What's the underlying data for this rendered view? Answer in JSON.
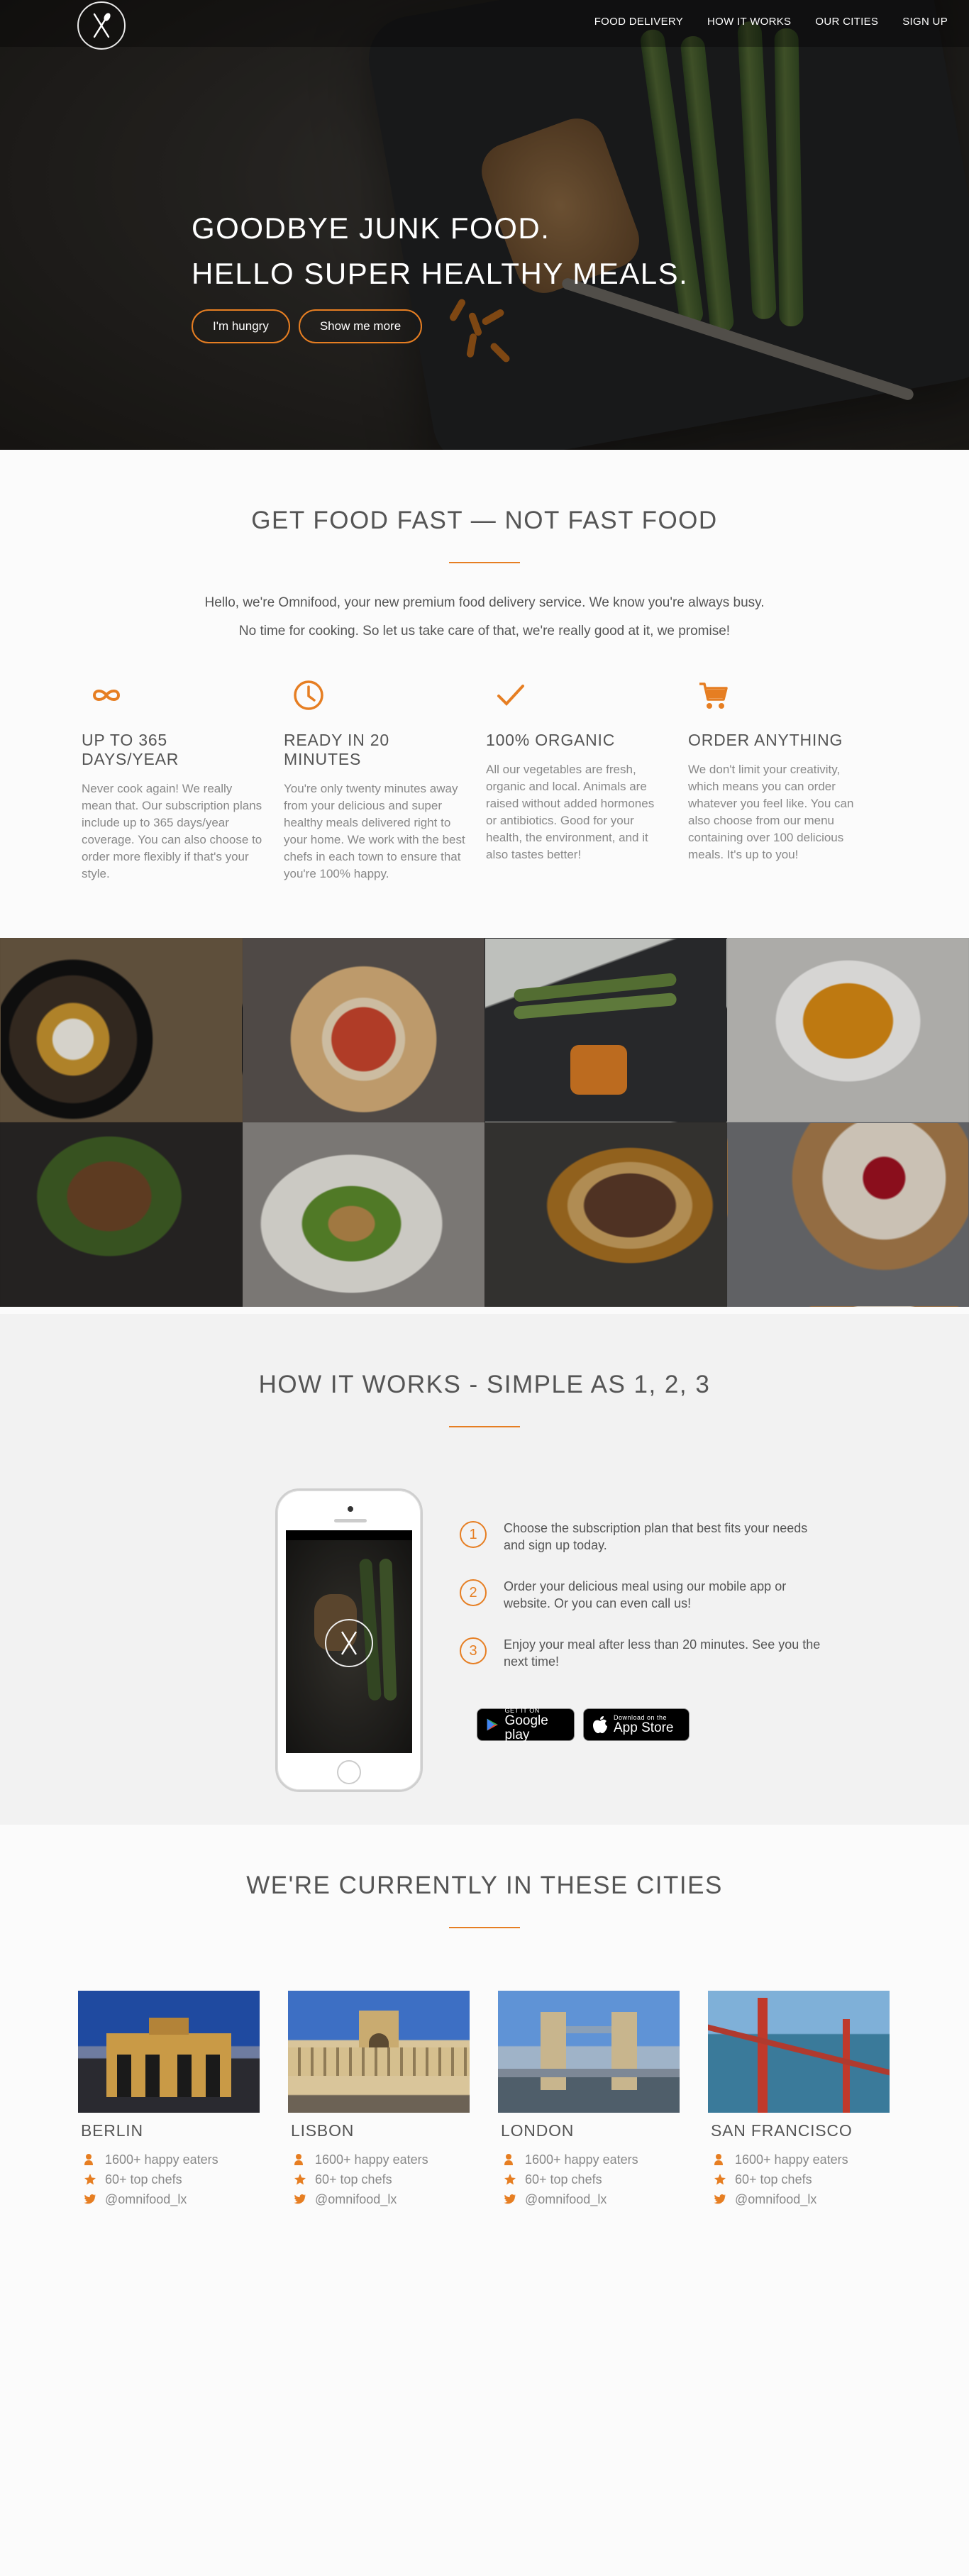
{
  "nav": {
    "items": [
      "Food delivery",
      "How it works",
      "Our cities",
      "Sign up"
    ]
  },
  "hero": {
    "line1": "Goodbye junk food.",
    "line2": "Hello super healthy meals.",
    "btn_primary": "I'm hungry",
    "btn_secondary": "Show me more"
  },
  "features_section": {
    "title": "Get food fast — not fast food",
    "intro1": "Hello, we're Omnifood, your new premium food delivery service. We know you're always busy.",
    "intro2": "No time for cooking. So let us take care of that, we're really good at it, we promise!",
    "items": [
      {
        "icon": "infinity-icon",
        "title": "Up to 365 days/year",
        "text": "Never cook again! We really mean that. Our subscription plans include up to 365 days/year coverage. You can also choose to order more flexibly if that's your style."
      },
      {
        "icon": "clock-icon",
        "title": "Ready in 20 minutes",
        "text": "You're only twenty minutes away from your delicious and super healthy meals delivered right to your home. We work with the best chefs in each town to ensure that you're 100% happy."
      },
      {
        "icon": "checkmark-icon",
        "title": "100% organic",
        "text": "All our vegetables are fresh, organic and local. Animals are raised without added hormones or antibiotics. Good for your health, the environment, and it also tastes better!"
      },
      {
        "icon": "cart-icon",
        "title": "Order anything",
        "text": "We don't limit your creativity, which means you can order whatever you feel like. You can also choose from our menu containing over 100 delicious meals. It's up to you!"
      }
    ]
  },
  "how": {
    "title": "How it works - Simple as 1, 2, 3",
    "steps": [
      {
        "num": "1",
        "text": "Choose the subscription plan that best fits your needs and sign up today."
      },
      {
        "num": "2",
        "text": "Order your delicious meal using our mobile app or website. Or you can even call us!"
      },
      {
        "num": "3",
        "text": "Enjoy your meal after less than 20 minutes. See you the next time!"
      }
    ],
    "google_small": "GET IT ON",
    "google_big": "Google play",
    "apple_small": "Download on the",
    "apple_big": "App Store"
  },
  "cities_section": {
    "title": "We're currently in these cities",
    "cities": [
      {
        "name": "Berlin",
        "eaters": "1600+ happy eaters",
        "chefs": "60+ top chefs",
        "twitter": "@omnifood_lx"
      },
      {
        "name": "Lisbon",
        "eaters": "1600+ happy eaters",
        "chefs": "60+ top chefs",
        "twitter": "@omnifood_lx"
      },
      {
        "name": "London",
        "eaters": "1600+ happy eaters",
        "chefs": "60+ top chefs",
        "twitter": "@omnifood_lx"
      },
      {
        "name": "San Francisco",
        "eaters": "1600+ happy eaters",
        "chefs": "60+ top chefs",
        "twitter": "@omnifood_lx"
      }
    ]
  },
  "colors": {
    "accent": "#e67e22",
    "text": "#555555",
    "muted": "#888888"
  }
}
